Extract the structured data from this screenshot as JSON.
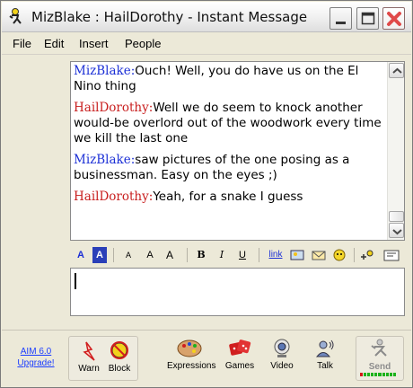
{
  "window": {
    "title": "MizBlake : HailDorothy - Instant Message"
  },
  "menu": [
    "File",
    "Edit",
    "Insert",
    "People"
  ],
  "conversation": [
    {
      "sender": "MizBlake",
      "sep": ":",
      "text": "Ouch! Well, you do have us on the El Nino thing",
      "color": "#1b2fd6"
    },
    {
      "sender": "HailDorothy",
      "sep": ":",
      "text": "Well we do seem to knock another would-be overlord out of the woodwork every time we kill the last one",
      "color": "#c81e1e"
    },
    {
      "sender": "MizBlake",
      "sep": ":",
      "text": "saw pictures of the one posing as a businessman. Easy on the eyes ;)",
      "color": "#1b2fd6"
    },
    {
      "sender": "HailDorothy",
      "sep": ":",
      "text": "Yeah, for a snake I guess",
      "color": "#c81e1e"
    }
  ],
  "format_toolbar": {
    "text_color": "A",
    "bg_color": "A",
    "smaller_font": "A",
    "normal_font": "A",
    "larger_font": "A",
    "bold": "B",
    "italic": "I",
    "underline": "U",
    "link": "link"
  },
  "compose": {
    "value": ""
  },
  "bottom": {
    "upgrade_line1": "AIM 6.0",
    "upgrade_line2": "Upgrade!",
    "warn": "Warn",
    "block": "Block",
    "expressions": "Expressions",
    "games": "Games",
    "video": "Video",
    "talk": "Talk",
    "send": "Send"
  },
  "colors": {
    "local_user": "#1b2fd6",
    "remote_user": "#c81e1e",
    "link": "#1a3cff",
    "window_bg": "#ece9d8"
  }
}
